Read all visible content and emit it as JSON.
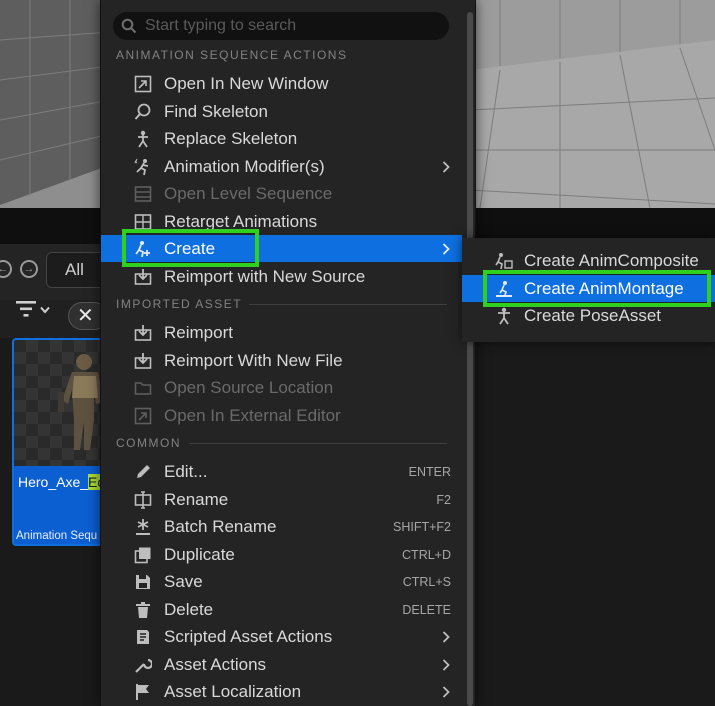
{
  "search": {
    "placeholder": "Start typing to search"
  },
  "toolbar": {
    "all_label": "All"
  },
  "asset_tile": {
    "name_prefix": "Hero_Axe_",
    "name_highlight": "Ec",
    "type_label": "Animation Sequ"
  },
  "menu": {
    "sections": {
      "animation_sequence_actions": "ANIMATION SEQUENCE ACTIONS",
      "imported_asset": "IMPORTED ASSET",
      "common": "COMMON"
    },
    "items": {
      "open_in_new_window": "Open In New Window",
      "find_skeleton": "Find Skeleton",
      "replace_skeleton": "Replace Skeleton",
      "animation_modifiers": "Animation Modifier(s)",
      "open_level_sequence": "Open Level Sequence",
      "retarget_animations": "Retarget Animations",
      "create": "Create",
      "reimport_with_new_source": "Reimport with New Source",
      "reimport": "Reimport",
      "reimport_with_new_file": "Reimport With New File",
      "open_source_location": "Open Source Location",
      "open_in_external_editor": "Open In External Editor",
      "edit": "Edit...",
      "rename": "Rename",
      "batch_rename": "Batch Rename",
      "duplicate": "Duplicate",
      "save": "Save",
      "delete": "Delete",
      "scripted_asset_actions": "Scripted Asset Actions",
      "asset_actions": "Asset Actions",
      "asset_localization": "Asset Localization"
    },
    "shortcuts": {
      "edit": "ENTER",
      "rename": "F2",
      "batch_rename": "SHIFT+F2",
      "duplicate": "CTRL+D",
      "save": "CTRL+S",
      "delete": "DELETE"
    }
  },
  "submenu": {
    "items": {
      "create_anim_composite": "Create AnimComposite",
      "create_anim_montage": "Create AnimMontage",
      "create_pose_asset": "Create PoseAsset"
    }
  },
  "colors": {
    "accent": "#0e6fe0",
    "callout": "#2fd11f",
    "menu_bg": "#242424",
    "search_highlight": "#aede35"
  }
}
